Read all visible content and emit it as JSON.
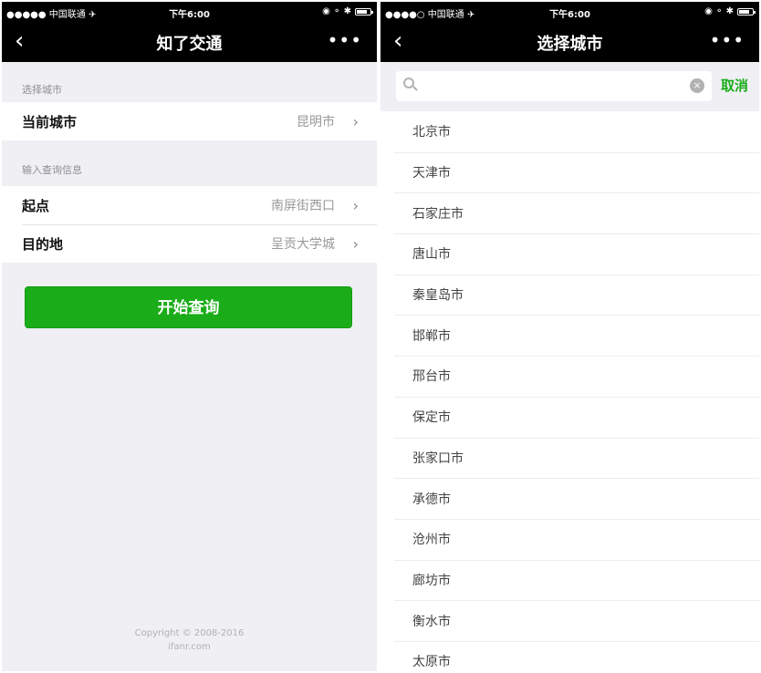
{
  "left": {
    "status": {
      "carrier": "●●●●● 中国联通 ✈",
      "time": "下午6:00",
      "icons": "◉ ⚬ ✱"
    },
    "nav": {
      "back": "‹",
      "title": "知了交通",
      "more": "•••"
    },
    "sections": [
      {
        "title": "选择城市",
        "cells": [
          {
            "label": "当前城市",
            "value": "昆明市",
            "chevron": "›"
          }
        ]
      },
      {
        "title": "输入查询信息",
        "cells": [
          {
            "label": "起点",
            "value": "南屏街西口",
            "chevron": "›"
          },
          {
            "label": "目的地",
            "value": "呈贡大学城",
            "chevron": "›"
          }
        ]
      }
    ],
    "button": "开始查询",
    "copyright": {
      "line1": "Copyright © 2008-2016",
      "line2": "ifanr.com"
    }
  },
  "right": {
    "status": {
      "carrier": "●●●●○ 中国联通 ✈",
      "time": "下午6:00",
      "icons": "◉ ⚬ ✱"
    },
    "nav": {
      "back": "‹",
      "title": "选择城市",
      "more": "•••"
    },
    "search": {
      "placeholder": "",
      "value": "",
      "clear": "×",
      "cancel": "取消"
    },
    "cities": [
      "北京市",
      "天津市",
      "石家庄市",
      "唐山市",
      "秦皇岛市",
      "邯郸市",
      "邢台市",
      "保定市",
      "张家口市",
      "承德市",
      "沧州市",
      "廊坊市",
      "衡水市",
      "太原市"
    ]
  }
}
